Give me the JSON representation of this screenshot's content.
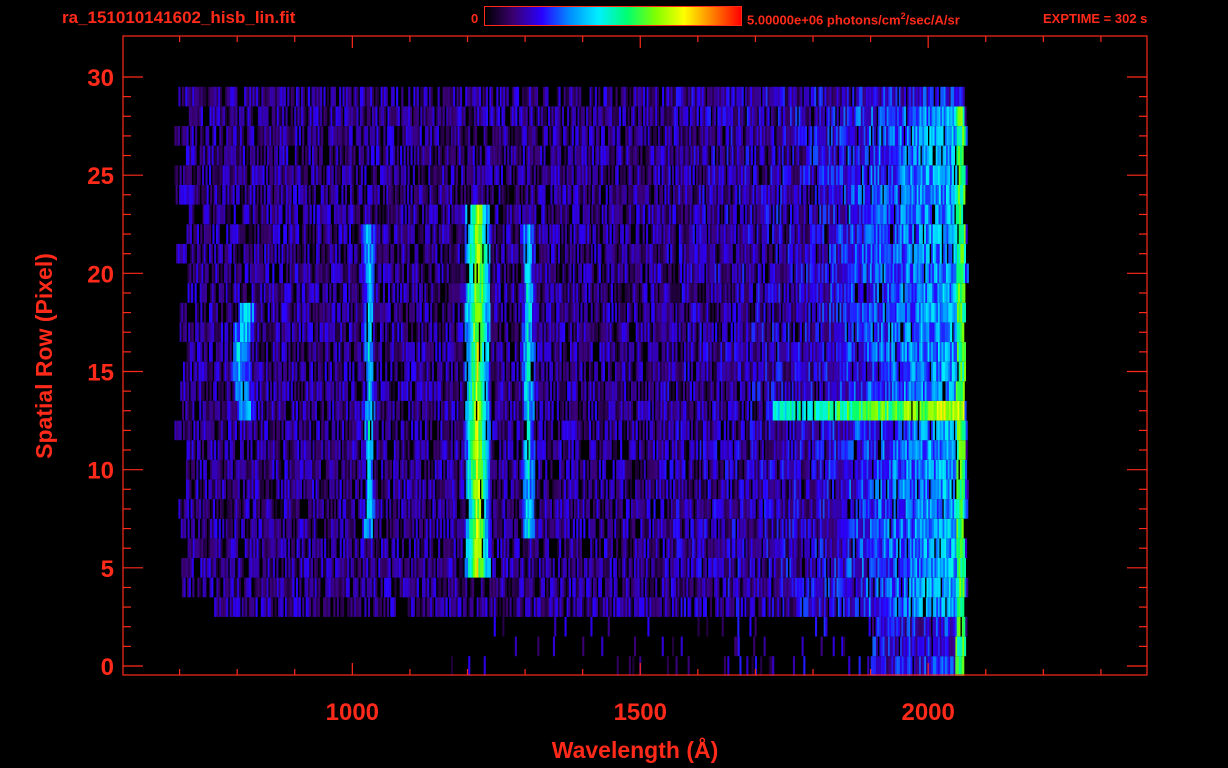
{
  "header": {
    "title": "ra_151010141602_hisb_lin.fit",
    "colorbar_min": "0",
    "colorbar_max_pre": "5.00000e+06 photons/cm",
    "colorbar_max_sup": "2",
    "colorbar_max_post": "/sec/A/sr",
    "exptime": "EXPTIME = 302 s"
  },
  "colors": {
    "axis": "#ff2a1a",
    "background": "#000000",
    "colormap": [
      "#000000",
      "#3a0070",
      "#2a00ff",
      "#0090ff",
      "#00f0ff",
      "#00ff70",
      "#80ff00",
      "#ffff00",
      "#ff8000",
      "#ff0000"
    ]
  },
  "chart_data": {
    "type": "heatmap",
    "title": "ra_151010141602_hisb_lin.fit",
    "xlabel": "Wavelength (Å)",
    "ylabel": "Spatial Row (Pixel)",
    "xlim": [
      600,
      2380
    ],
    "ylim": [
      0,
      30
    ],
    "x_ticks": [
      1000,
      1500,
      2000
    ],
    "y_ticks": [
      0,
      5,
      10,
      15,
      20,
      25,
      30
    ],
    "color_scale": {
      "min": 0,
      "max": "5.00000e+06 photons/cm^2/sec/A/sr"
    },
    "data_x_range": [
      765,
      2065
    ],
    "data_row_range": [
      0,
      29
    ],
    "features": [
      {
        "name": "emission line",
        "wavelength": 1216,
        "rows": [
          5,
          23
        ],
        "level": 0.72
      },
      {
        "name": "emission line",
        "wavelength": 1304,
        "rows": [
          7,
          22
        ],
        "level": 0.45
      },
      {
        "name": "emission line",
        "wavelength": 1027,
        "rows": [
          7,
          22
        ],
        "level": 0.42
      },
      {
        "name": "curved feature",
        "wavelength": 800,
        "rows": [
          13,
          18
        ],
        "level": 0.45
      },
      {
        "name": "bright row",
        "row": 13,
        "wavelength_range": [
          1730,
          2060
        ],
        "level": 0.62
      },
      {
        "name": "long-wavelength continuum",
        "wavelength_range": [
          1800,
          2060
        ],
        "rows": [
          3,
          28
        ],
        "level": 0.4
      },
      {
        "name": "edge",
        "wavelength": 2055,
        "rows": [
          0,
          28
        ],
        "level": 0.58
      }
    ]
  }
}
